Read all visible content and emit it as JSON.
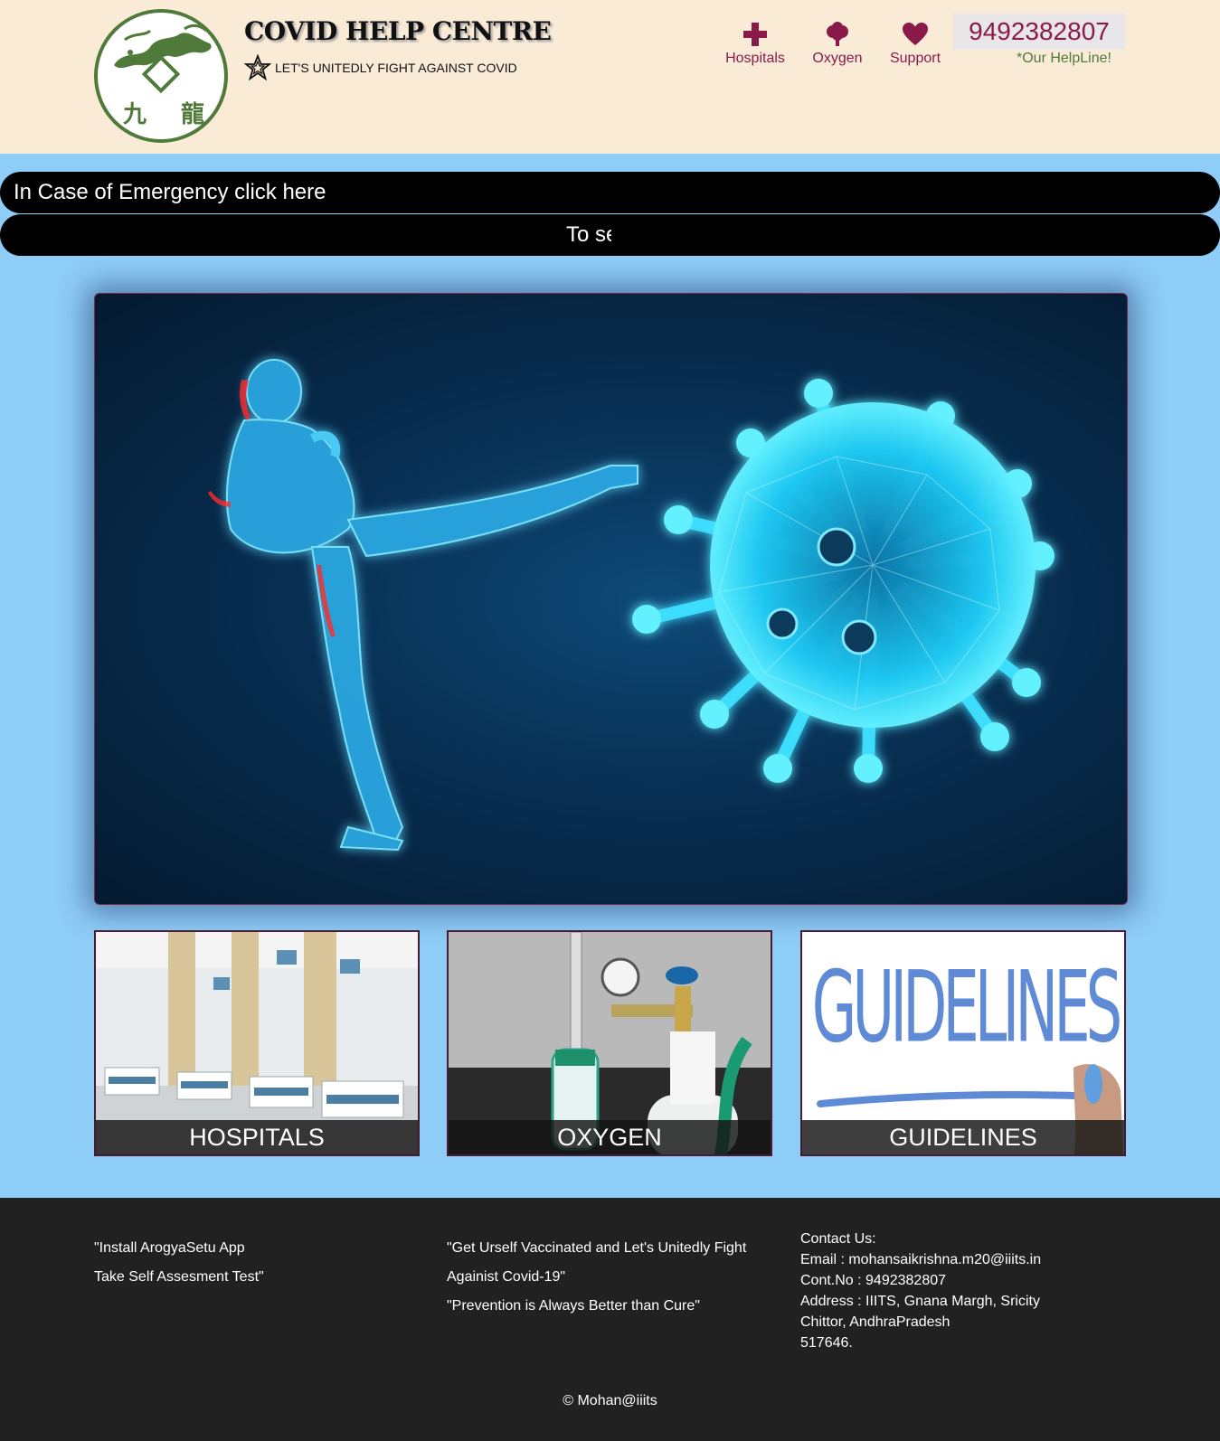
{
  "header": {
    "title": "COVID HELP CENTRE",
    "tagline": "LET'S UNITEDLY FIGHT AGAINST COVID",
    "logo_text": [
      "九",
      "龍"
    ],
    "nav": [
      {
        "label": "Hospitals",
        "icon": "plus-icon"
      },
      {
        "label": "Oxygen",
        "icon": "tree-icon"
      },
      {
        "label": "Support",
        "icon": "heart-icon"
      }
    ],
    "helpline_number": "9492382807",
    "helpline_note": "*Our HelpLine!"
  },
  "emergency": {
    "primary": "In Case of Emergency click here",
    "marquee": "To se"
  },
  "hero": {
    "alt_icon": "kick-virus-illustration"
  },
  "cards": [
    {
      "label": "HOSPITALS"
    },
    {
      "label": "OXYGEN"
    },
    {
      "label": "GUIDELINES",
      "image_text": "GUIDELINES"
    }
  ],
  "footer": {
    "col1": [
      "\"Install ArogyaSetu App",
      "Take Self Assesment Test\""
    ],
    "col2": [
      "\"Get Urself Vaccinated and Let's Unitedly Fight",
      "Againist Covid-19\"",
      "\"Prevention is Always Better than Cure\""
    ],
    "contact": [
      "Contact Us:",
      "Email : mohansaikrishna.m20@iiits.in",
      "Cont.No : 9492382807",
      "Address : IIITS, Gnana Margh, Sricity",
      "Chittor, AndhraPradesh",
      "517646."
    ],
    "copyright": "© Mohan@iiits"
  },
  "colors": {
    "header_bg": "#faebd7",
    "page_bg": "#8ecdf7",
    "accent": "#8a1a4a",
    "green": "#4f7a3a",
    "footer_bg": "#212121"
  }
}
